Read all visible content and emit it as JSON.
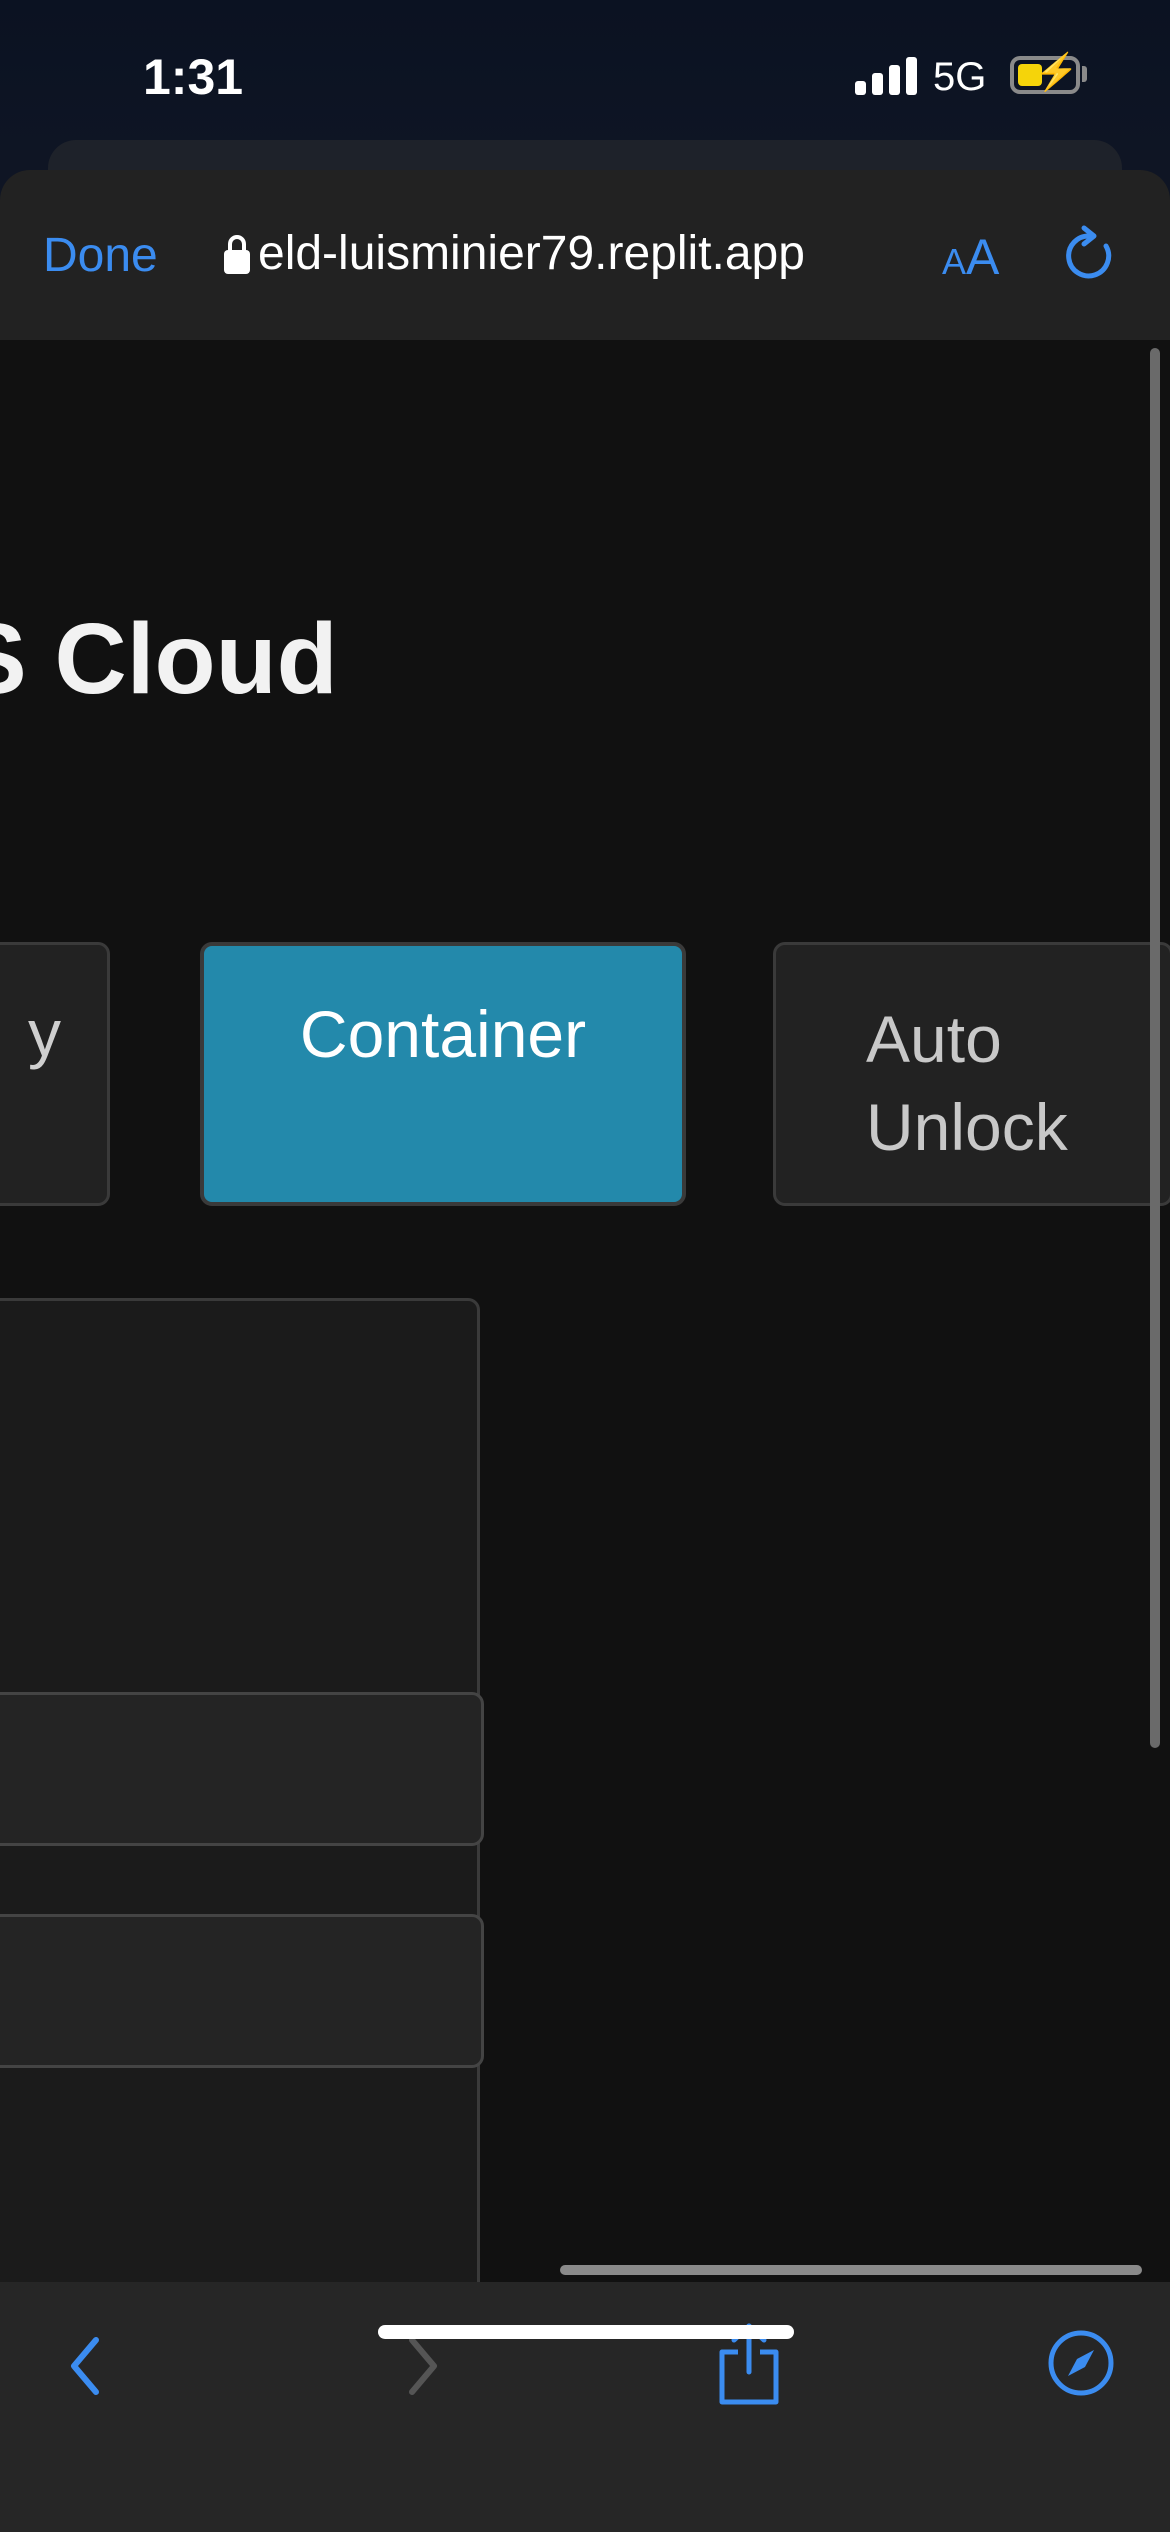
{
  "status_bar": {
    "time": "1:31",
    "network": "5G",
    "battery_charging": true,
    "battery_level_fraction": 0.45
  },
  "browser": {
    "done_label": "Done",
    "url": "eld-luisminier79.replit.app",
    "text_size_small": "A",
    "text_size_big": "A",
    "icons": {
      "lock": "lock-icon",
      "reload": "reload-icon",
      "back": "chevron-left-icon",
      "forward": "chevron-right-icon",
      "share": "share-icon",
      "bookmarks": "compass-icon"
    },
    "accent_color": "#3b8cf0"
  },
  "page": {
    "title": "S Cloud",
    "tabs": [
      {
        "label": "y",
        "selected": false
      },
      {
        "label": "Container",
        "selected": true
      },
      {
        "label": "Auto Unlock",
        "selected": false
      }
    ],
    "selected_tab_color": "#2389ab"
  }
}
